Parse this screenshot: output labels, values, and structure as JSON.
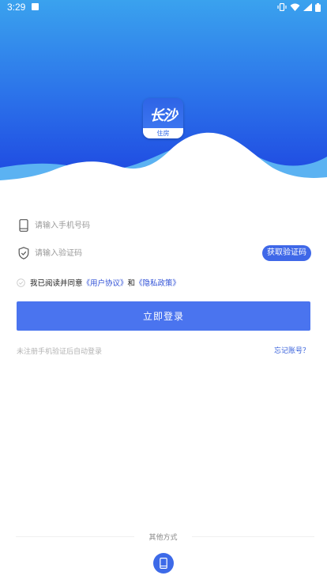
{
  "status_bar": {
    "time": "3:29"
  },
  "logo": {
    "title": "长沙",
    "subtitle": "住房"
  },
  "form": {
    "phone_placeholder": "请输入手机号码",
    "code_placeholder": "请输入验证码",
    "get_code_label": "获取验证码"
  },
  "agreement": {
    "prefix": "我已阅读并同意",
    "user_agreement": "《用户协议》",
    "and": "和",
    "privacy_policy": "《隐私政策》"
  },
  "login_button": "立即登录",
  "hint": "未注册手机验证后自动登录",
  "forgot": "忘记账号？",
  "other_methods": "其他方式",
  "colors": {
    "primary": "#4a74ef",
    "link": "#2e4fd6",
    "hero_top": "#3aa2ee",
    "hero_bottom": "#1d43e0"
  },
  "icons": [
    "phone-icon",
    "shield-icon",
    "check-icon",
    "mobile-login-icon",
    "vibrate-icon",
    "wifi-icon",
    "signal-icon",
    "battery-icon"
  ]
}
